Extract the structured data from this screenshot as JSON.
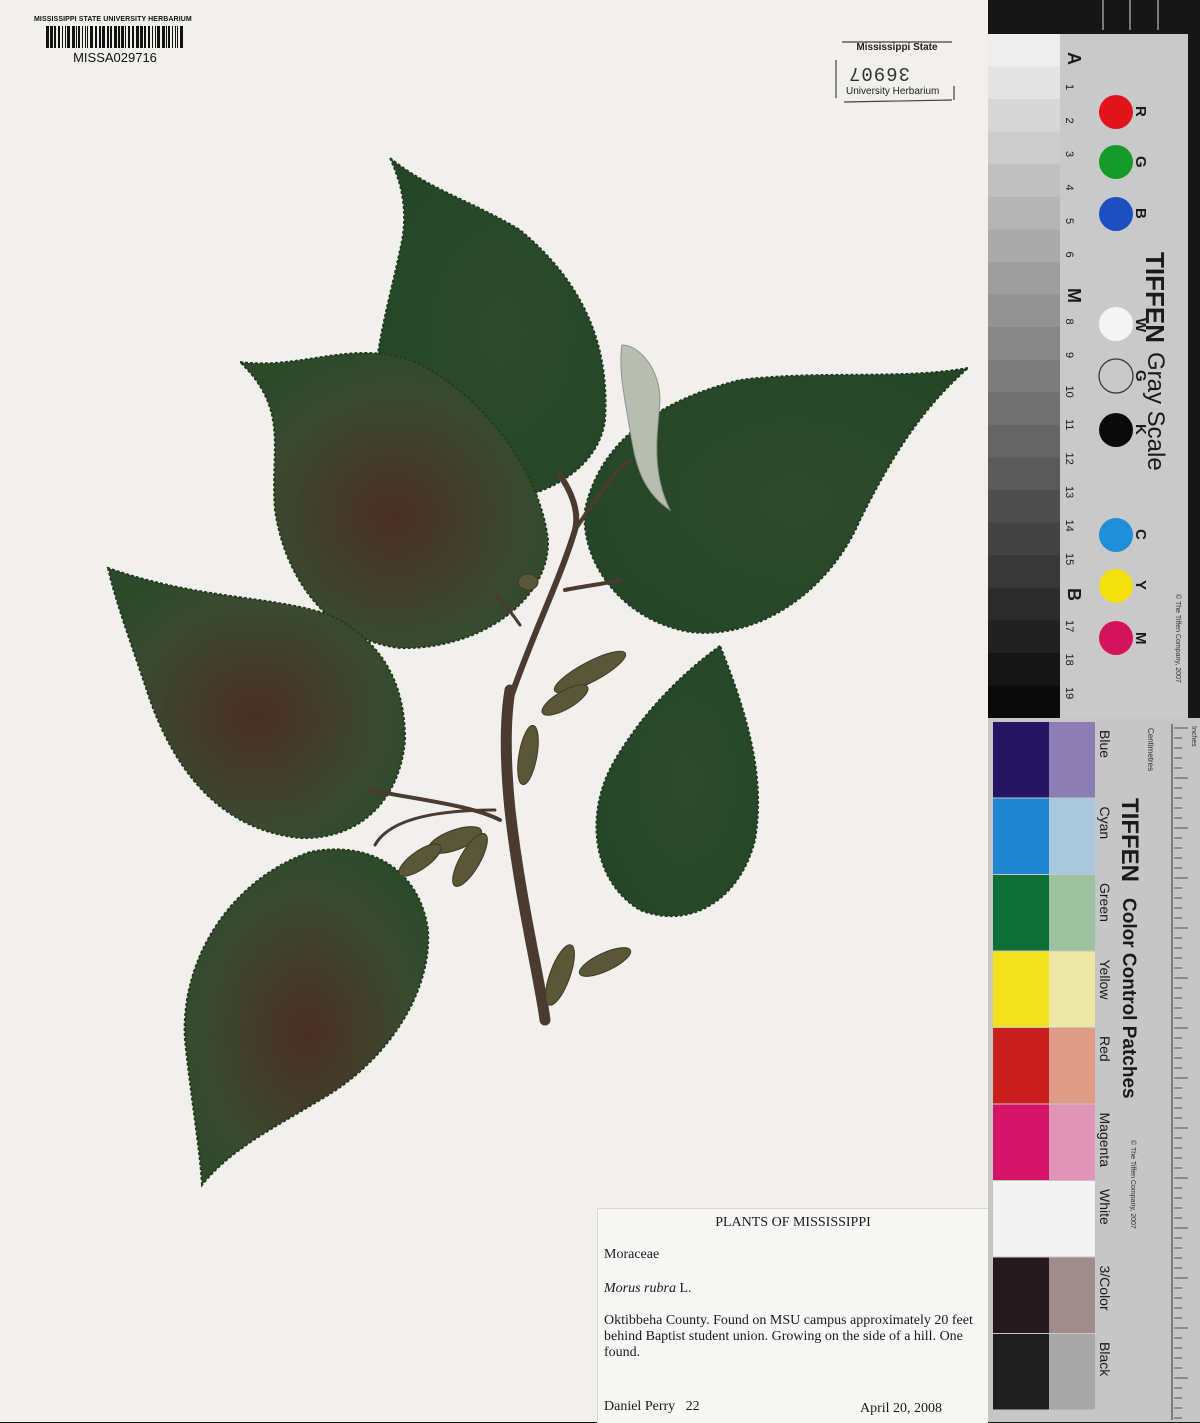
{
  "sheet": {
    "herbarium_name": "MISSISSIPPI STATE UNIVERSITY HERBARIUM",
    "catalog_number": "MISSA029716",
    "stamp": {
      "top": "Mississippi State",
      "number": "36907",
      "bottom": "University Herbarium"
    }
  },
  "label": {
    "title": "PLANTS OF MISSISSIPPI",
    "family": "Moraceae",
    "genus_species": "Morus rubra",
    "author": "L.",
    "locality": "Oktibbeha County. Found on MSU campus approximately 20 feet behind Baptist student union. Growing on the side of a hill. One found.",
    "collector": "Daniel Perry",
    "collector_number": "22",
    "date": "April 20, 2008"
  },
  "gray_scale": {
    "brand": "TIFFEN",
    "title": "Gray Scale",
    "copyright": "© The Tiffen Company, 2007",
    "letters": [
      "A",
      "M",
      "B"
    ],
    "numbers": [
      "1",
      "2",
      "3",
      "4",
      "5",
      "6",
      "",
      "8",
      "9",
      "10",
      "11",
      "12",
      "13",
      "14",
      "15",
      "",
      "17",
      "18",
      "19"
    ],
    "dot_letters": [
      "R",
      "G",
      "B",
      "W",
      "G",
      "K",
      "C",
      "Y",
      "M"
    ],
    "dot_colors": [
      "#e0141a",
      "#159a2a",
      "#1d4fc0",
      "#f4f4f4",
      "#3a3a3a",
      "#0a0a0a",
      "#1f8fd8",
      "#f2e10a",
      "#d4145a"
    ]
  },
  "color_patches": {
    "brand": "TIFFEN",
    "title": "Color Control Patches",
    "copyright": "© The Tiffen Company, 2007",
    "unit": "Centimetres",
    "inches": "Inches",
    "names": [
      "Blue",
      "Cyan",
      "Green",
      "Yellow",
      "Red",
      "Magenta",
      "White",
      "3/Color",
      "Black"
    ],
    "left_colors": [
      "#251563",
      "#1f85d0",
      "#0f6e36",
      "#f1e21c",
      "#c81e1e",
      "#d31467",
      "#f3f3f3",
      "#241a1e",
      "#1e1e1e"
    ],
    "right_colors": [
      "#8c7db3",
      "#a9c8de",
      "#9ec2a0",
      "#ede8a6",
      "#df9b86",
      "#e095b6",
      "#f3f3f3",
      "#a08c8a",
      "#a8a8a8"
    ]
  }
}
